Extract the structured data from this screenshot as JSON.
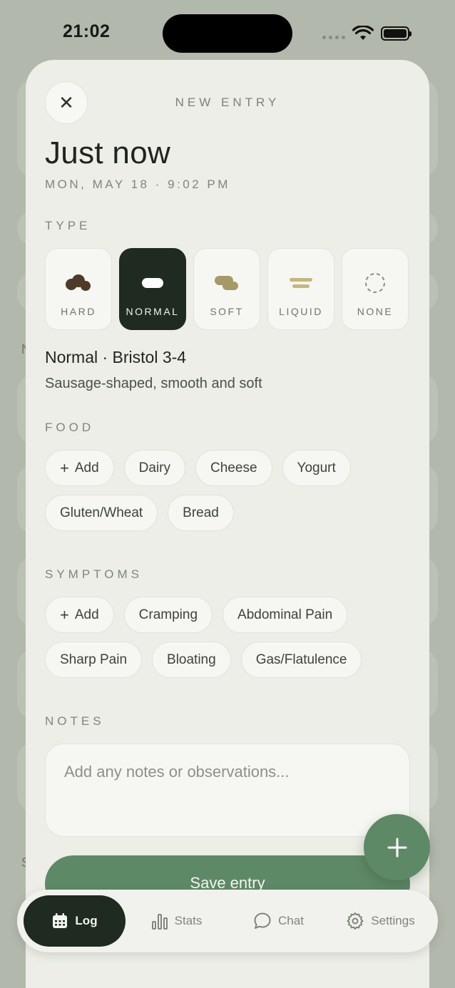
{
  "status_bar": {
    "time": "21:02"
  },
  "sheet": {
    "title": "NEW ENTRY",
    "close_icon": "close-icon",
    "headline": "Just now",
    "datetime": "MON, MAY 18 · 9:02 PM",
    "type_section": {
      "label": "TYPE",
      "options": [
        {
          "label": "HARD",
          "icon": "hard-stool-icon",
          "selected": false
        },
        {
          "label": "NORMAL",
          "icon": "normal-stool-icon",
          "selected": true
        },
        {
          "label": "SOFT",
          "icon": "soft-stool-icon",
          "selected": false
        },
        {
          "label": "LIQUID",
          "icon": "liquid-stool-icon",
          "selected": false
        },
        {
          "label": "NONE",
          "icon": "none-dashed-circle-icon",
          "selected": false
        }
      ],
      "selected_name": "Normal · Bristol 3-4",
      "selected_description": "Sausage-shaped, smooth and soft"
    },
    "food_section": {
      "label": "FOOD",
      "add_label": "Add",
      "chips": [
        "Dairy",
        "Cheese",
        "Yogurt",
        "Gluten/Wheat",
        "Bread"
      ]
    },
    "symptoms_section": {
      "label": "SYMPTOMS",
      "add_label": "Add",
      "chips": [
        "Cramping",
        "Abdominal Pain",
        "Sharp Pain",
        "Bloating",
        "Gas/Flatulence"
      ]
    },
    "notes_section": {
      "label": "NOTES",
      "placeholder": "Add any notes or observations...",
      "value": ""
    },
    "save_label": "Save entry"
  },
  "fab": {
    "icon": "plus-icon"
  },
  "tab_bar": {
    "tabs": [
      {
        "label": "Log",
        "icon": "calendar-icon",
        "active": true
      },
      {
        "label": "Stats",
        "icon": "bar-chart-icon",
        "active": false
      },
      {
        "label": "Chat",
        "icon": "chat-bubble-icon",
        "active": false
      },
      {
        "label": "Settings",
        "icon": "gear-icon",
        "active": false
      }
    ]
  },
  "background": {
    "frag_1": "N",
    "frag_2": "S"
  },
  "colors": {
    "accent": "#5e8966",
    "selected": "#1f2a20",
    "sheet": "#eceee7"
  }
}
